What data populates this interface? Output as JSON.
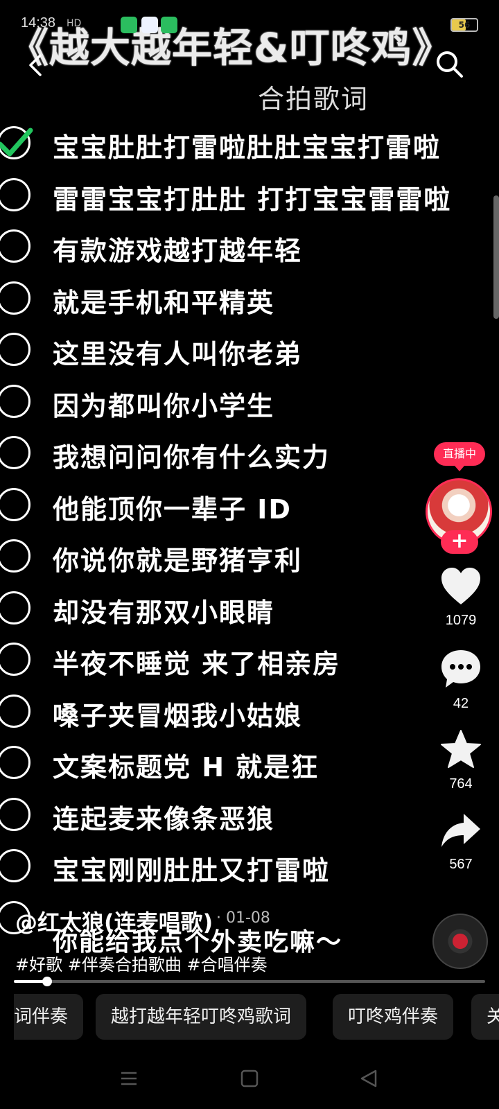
{
  "status_bar": {
    "time": "14:38",
    "signal": "HD",
    "battery": "56"
  },
  "video": {
    "title": "《越大越年轻&叮咚鸡》",
    "subtitle": "合拍歌词",
    "lyrics": [
      {
        "text": "宝宝肚肚打雷啦肚肚宝宝打雷啦",
        "checked": true
      },
      {
        "text": "雷雷宝宝打肚肚 打打宝宝雷雷啦",
        "checked": false
      },
      {
        "text": "有款游戏越打越年轻",
        "checked": false
      },
      {
        "text": "就是手机和平精英",
        "checked": false
      },
      {
        "text": "这里没有人叫你老弟",
        "checked": false
      },
      {
        "text": "因为都叫你小学生",
        "checked": false
      },
      {
        "text": "我想问问你有什么实力",
        "checked": false
      },
      {
        "text": "他能顶你一辈子 ID",
        "checked": false
      },
      {
        "text": "你说你就是野猪亨利",
        "checked": false
      },
      {
        "text": "却没有那双小眼睛",
        "checked": false
      },
      {
        "text": "半夜不睡觉 来了相亲房",
        "checked": false
      },
      {
        "text": "嗓子夹冒烟我小姑娘",
        "checked": false
      },
      {
        "text": "文案标题党 H 就是狂",
        "checked": false
      },
      {
        "text": "连起麦来像条恶狼",
        "checked": false
      },
      {
        "text": "宝宝刚刚肚肚又打雷啦",
        "checked": false
      },
      {
        "text": "你能给我点个外卖吃嘛～",
        "checked": false
      }
    ]
  },
  "side": {
    "live_badge": "直播中",
    "follow": "+",
    "likes": "1079",
    "comments": "42",
    "favorites": "764",
    "shares": "567"
  },
  "info": {
    "author": "@红太狼(连麦唱歌)",
    "date": "· 01-08",
    "hashtags": "#好歌 #伴奏合拍歌曲 #合唱伴奏",
    "progress": 0.07
  },
  "chips": [
    "词伴奏",
    "越打越年轻叮咚鸡歌词",
    "叮咚鸡伴奏",
    "关"
  ],
  "colors": {
    "accent": "#fe2c55",
    "check": "#22c55e"
  }
}
